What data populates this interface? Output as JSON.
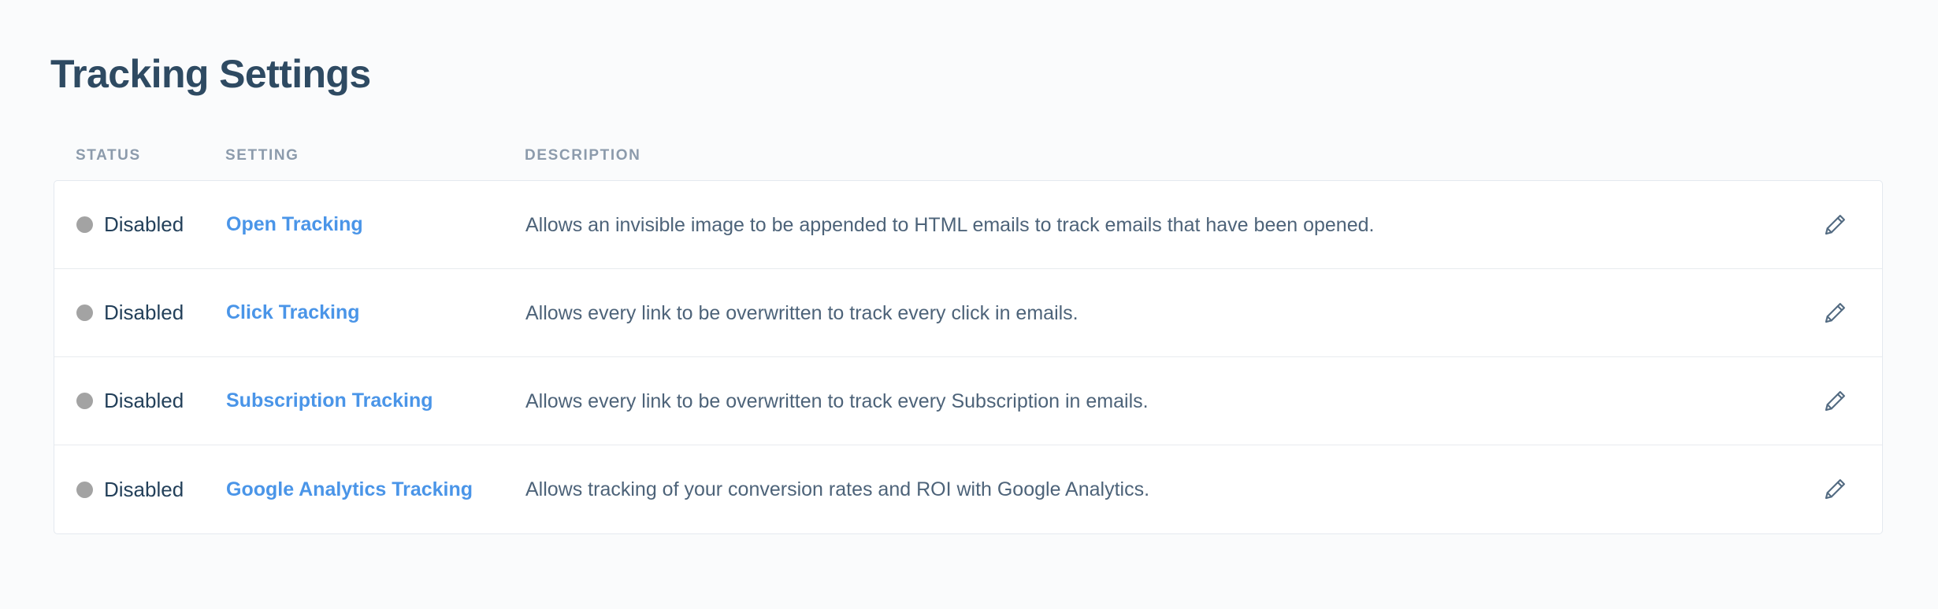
{
  "page": {
    "title": "Tracking Settings"
  },
  "table": {
    "headers": {
      "status": "STATUS",
      "setting": "SETTING",
      "description": "DESCRIPTION"
    },
    "rows": [
      {
        "status": "Disabled",
        "setting": "Open Tracking",
        "description": "Allows an invisible image to be appended to HTML emails to track emails that have been opened.",
        "edit_icon": "pencil-icon"
      },
      {
        "status": "Disabled",
        "setting": "Click Tracking",
        "description": "Allows every link to be overwritten to track every click in emails.",
        "edit_icon": "pencil-icon"
      },
      {
        "status": "Disabled",
        "setting": "Subscription Tracking",
        "description": "Allows every link to be overwritten to track every Subscription in emails.",
        "edit_icon": "pencil-icon"
      },
      {
        "status": "Disabled",
        "setting": "Google Analytics Tracking",
        "description": "Allows tracking of your conversion rates and ROI with Google Analytics.",
        "edit_icon": "pencil-icon"
      }
    ]
  },
  "colors": {
    "page_background": "#fafbfc",
    "card_background": "#ffffff",
    "title_text": "#2e4a62",
    "header_text": "#8c9bac",
    "link_blue": "#4a95e8",
    "description_text": "#4d6379",
    "status_text": "#23405a",
    "status_dot_disabled": "#a3a3a3",
    "border": "#e4e9ef",
    "row_divider": "#e8ebef",
    "icon": "#536b82"
  }
}
